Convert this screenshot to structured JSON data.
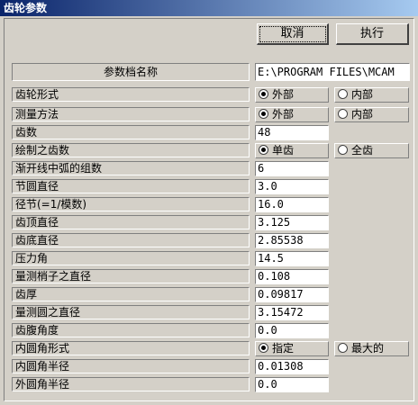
{
  "window": {
    "title": "齿轮参数"
  },
  "buttons": {
    "cancel": "取消",
    "execute": "执行"
  },
  "param_file": {
    "label": "参数档名称",
    "value": "E:\\PROGRAM FILES\\MCAM"
  },
  "rows": [
    {
      "label": "齿轮形式",
      "opt_a": "外部",
      "opt_b": "内部"
    },
    {
      "label": "测量方法",
      "opt_a": "外部",
      "opt_b": "内部"
    },
    {
      "label": "齿数",
      "value": "48"
    },
    {
      "label": "绘制之齿数",
      "opt_a": "单齿",
      "opt_b": "全齿"
    },
    {
      "label": "渐开线中弧的组数",
      "value": "6"
    },
    {
      "label": "节圆直径",
      "value": "3.0"
    },
    {
      "label": "径节(=1/模数)",
      "value": "16.0"
    },
    {
      "label": "齿顶直径",
      "value": "3.125"
    },
    {
      "label": "齿底直径",
      "value": "2.85538"
    },
    {
      "label": "压力角",
      "value": "14.5"
    },
    {
      "label": "量测梢子之直径",
      "value": "0.108"
    },
    {
      "label": "齿厚",
      "value": "0.09817"
    },
    {
      "label": "量测圆之直径",
      "value": "3.15472"
    },
    {
      "label": "齿腹角度",
      "value": "0.0"
    },
    {
      "label": "内圆角形式",
      "opt_a": "指定",
      "opt_b": "最大的"
    },
    {
      "label": "内圆角半径",
      "value": "0.01308"
    },
    {
      "label": "外圆角半径",
      "value": "0.0"
    }
  ]
}
